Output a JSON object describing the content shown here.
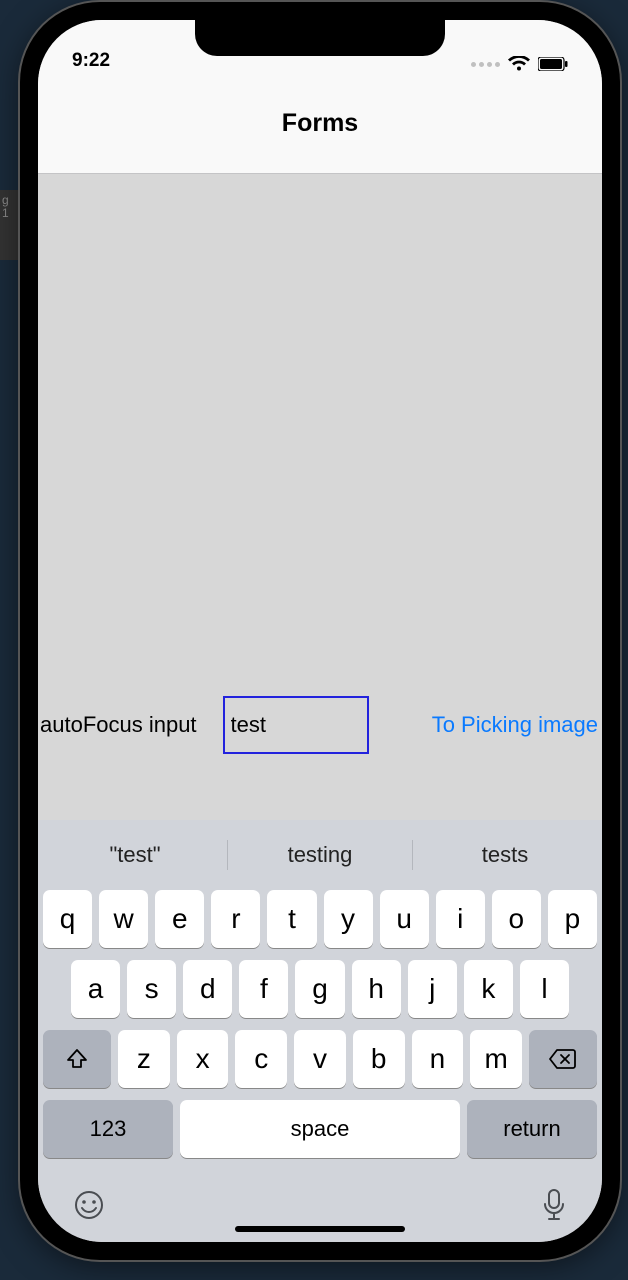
{
  "status": {
    "time": "9:22"
  },
  "nav": {
    "title": "Forms"
  },
  "form": {
    "label": "autoFocus input",
    "value": "test",
    "link": "To Picking image"
  },
  "keyboard": {
    "suggestions": [
      "\"test\"",
      "testing",
      "tests"
    ],
    "rows": [
      [
        "q",
        "w",
        "e",
        "r",
        "t",
        "y",
        "u",
        "i",
        "o",
        "p"
      ],
      [
        "a",
        "s",
        "d",
        "f",
        "g",
        "h",
        "j",
        "k",
        "l"
      ],
      [
        "z",
        "x",
        "c",
        "v",
        "b",
        "n",
        "m"
      ]
    ],
    "num_key": "123",
    "space": "space",
    "return": "return"
  }
}
